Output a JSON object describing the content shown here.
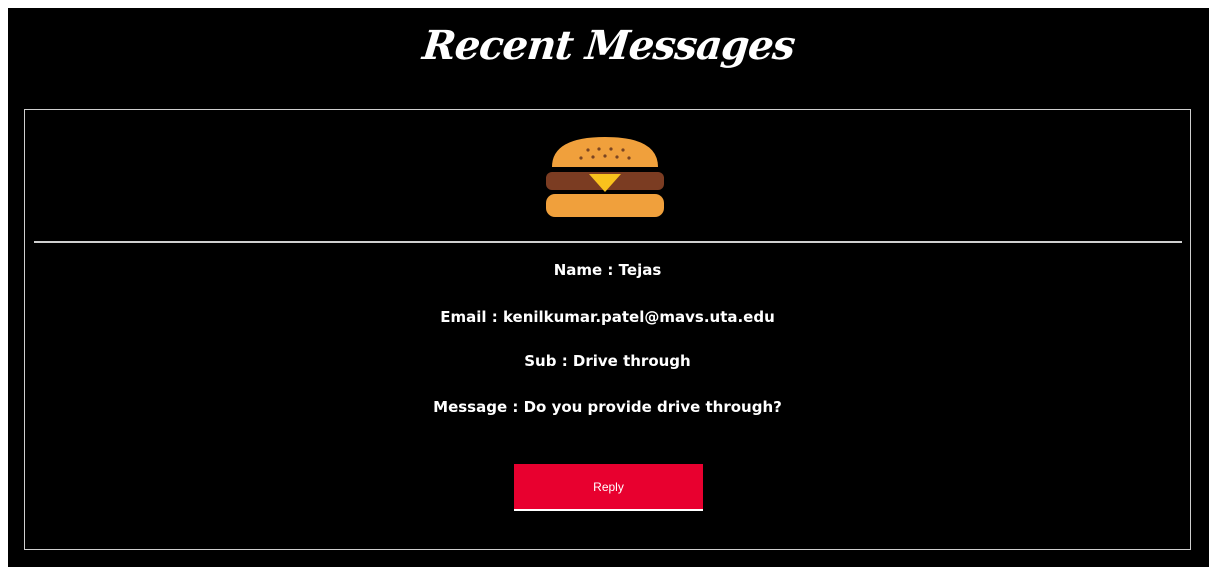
{
  "header": {
    "title": "Recent Messages"
  },
  "message": {
    "icon": "hamburger-icon",
    "name_line": "Name : Tejas",
    "email_line": "Email : kenilkumar.patel@mavs.uta.edu",
    "subject_line": "Sub : Drive through",
    "message_line": "Message : Do you provide drive through?",
    "reply_label": "Reply"
  },
  "colors": {
    "background": "#000000",
    "accent": "#e8002f",
    "text": "#ffffff",
    "border": "#cfcfcf"
  }
}
